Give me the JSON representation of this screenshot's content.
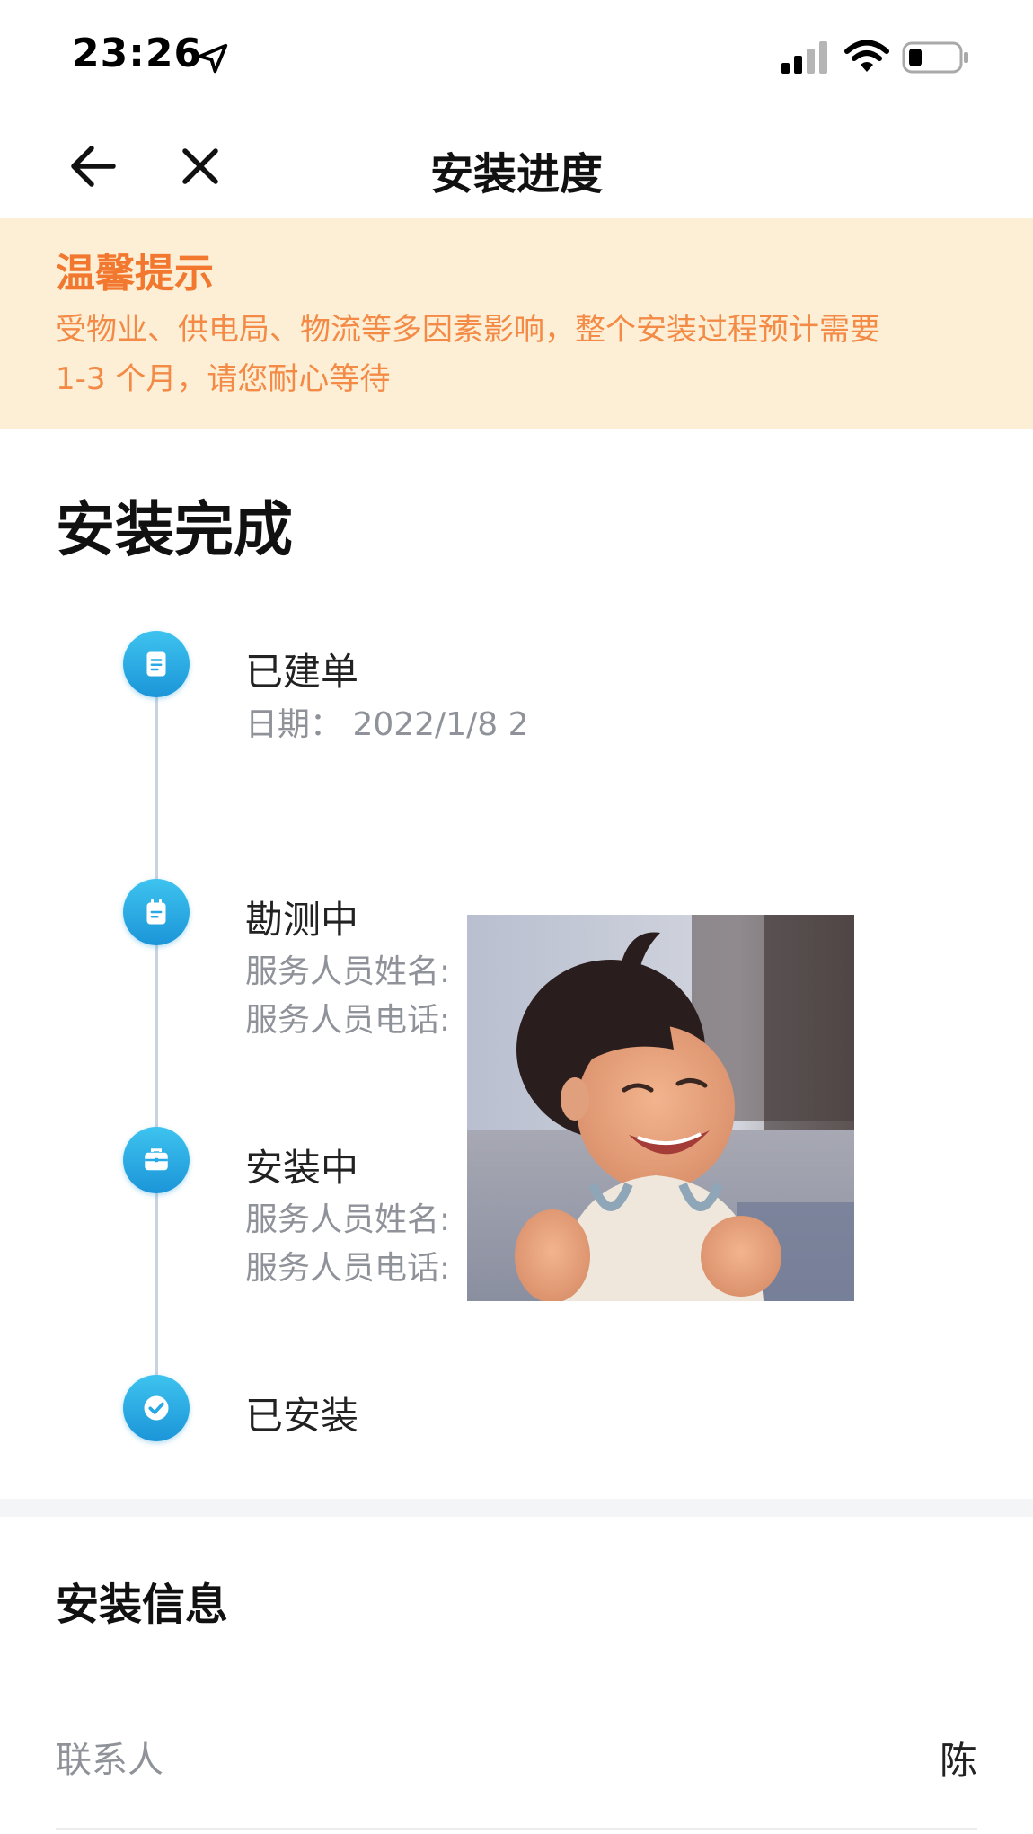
{
  "status_bar": {
    "time": "23:26"
  },
  "nav": {
    "title": "安装进度"
  },
  "tip": {
    "title": "温馨提示",
    "line1": "受物业、供电局、物流等多因素影响，整个安装过程预计需要",
    "line2": "1-3 个月，请您耐心等待"
  },
  "status_title": "安装完成",
  "steps": [
    {
      "label": "已建单",
      "detail1": "日期：  2022/1/8 2",
      "icon": "document-icon"
    },
    {
      "label": "勘测中",
      "detail1": "服务人员姓名:",
      "detail2": "服务人员电话:",
      "icon": "clipboard-icon"
    },
    {
      "label": "安装中",
      "detail1": "服务人员姓名:",
      "detail2": "服务人员电话:",
      "icon": "toolbox-icon"
    },
    {
      "label": "已安装",
      "icon": "check-icon"
    }
  ],
  "info": {
    "title": "安装信息",
    "contact_label": "联系人",
    "contact_value": "陈"
  },
  "colors": {
    "accent_blue": "#1b95d8",
    "tip_bg": "#fdefd6",
    "tip_text": "#f38a45"
  }
}
